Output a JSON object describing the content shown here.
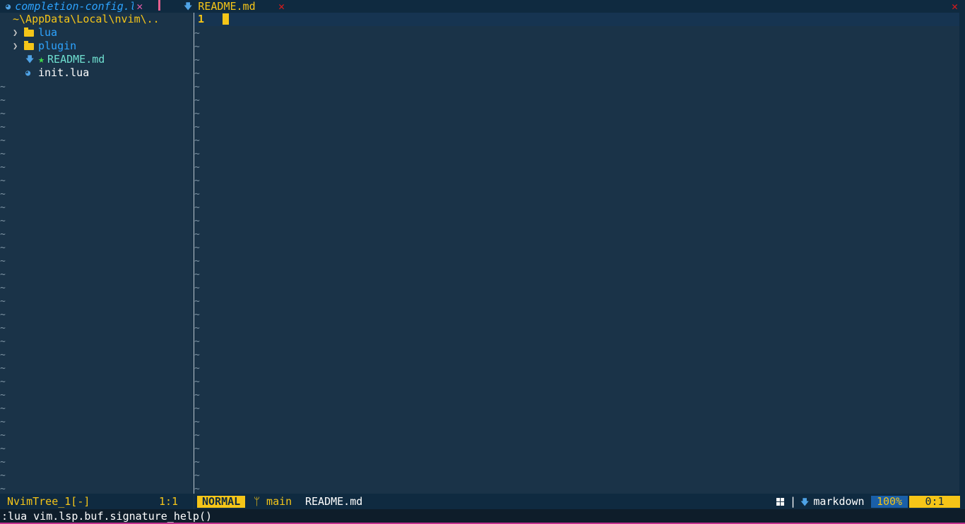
{
  "tabline": {
    "tabs": [
      {
        "label": "completion-config.lua",
        "icon": "lua-icon",
        "close": "✕"
      },
      {
        "label": "README.md",
        "icon": "markdown-icon",
        "close": "✕"
      }
    ],
    "close_all": "✕"
  },
  "nvimtree": {
    "root": "~\\AppData\\Local\\nvim\\..",
    "items": [
      {
        "type": "dir",
        "label": "lua",
        "icon": "folder-icon"
      },
      {
        "type": "dir",
        "label": "plugin",
        "icon": "folder-icon"
      },
      {
        "type": "file",
        "label": "README.md",
        "icon": "markdown-icon",
        "marker": "★"
      },
      {
        "type": "file",
        "label": "init.lua",
        "icon": "lua-icon"
      }
    ],
    "filler": "~"
  },
  "editor": {
    "current_line_number": "1",
    "filler": "~"
  },
  "statusline_left": {
    "buffer": "NvimTree_1[-]",
    "position": "1:1"
  },
  "statusline": {
    "mode": "NORMAL",
    "branch_icon": "ᛘ",
    "branch": "main",
    "filename": "README.md",
    "separator": "|",
    "filetype": "markdown",
    "percent": "100%",
    "location": "0:1"
  },
  "cmdline": ":lua vim.lsp.buf.signature_help()",
  "colors": {
    "background": "#1a3348",
    "accent_yellow": "#f5c518",
    "directory_blue": "#2ea4ff",
    "close_red": "#e01a1a",
    "modified_star_green": "#3fd94a"
  }
}
